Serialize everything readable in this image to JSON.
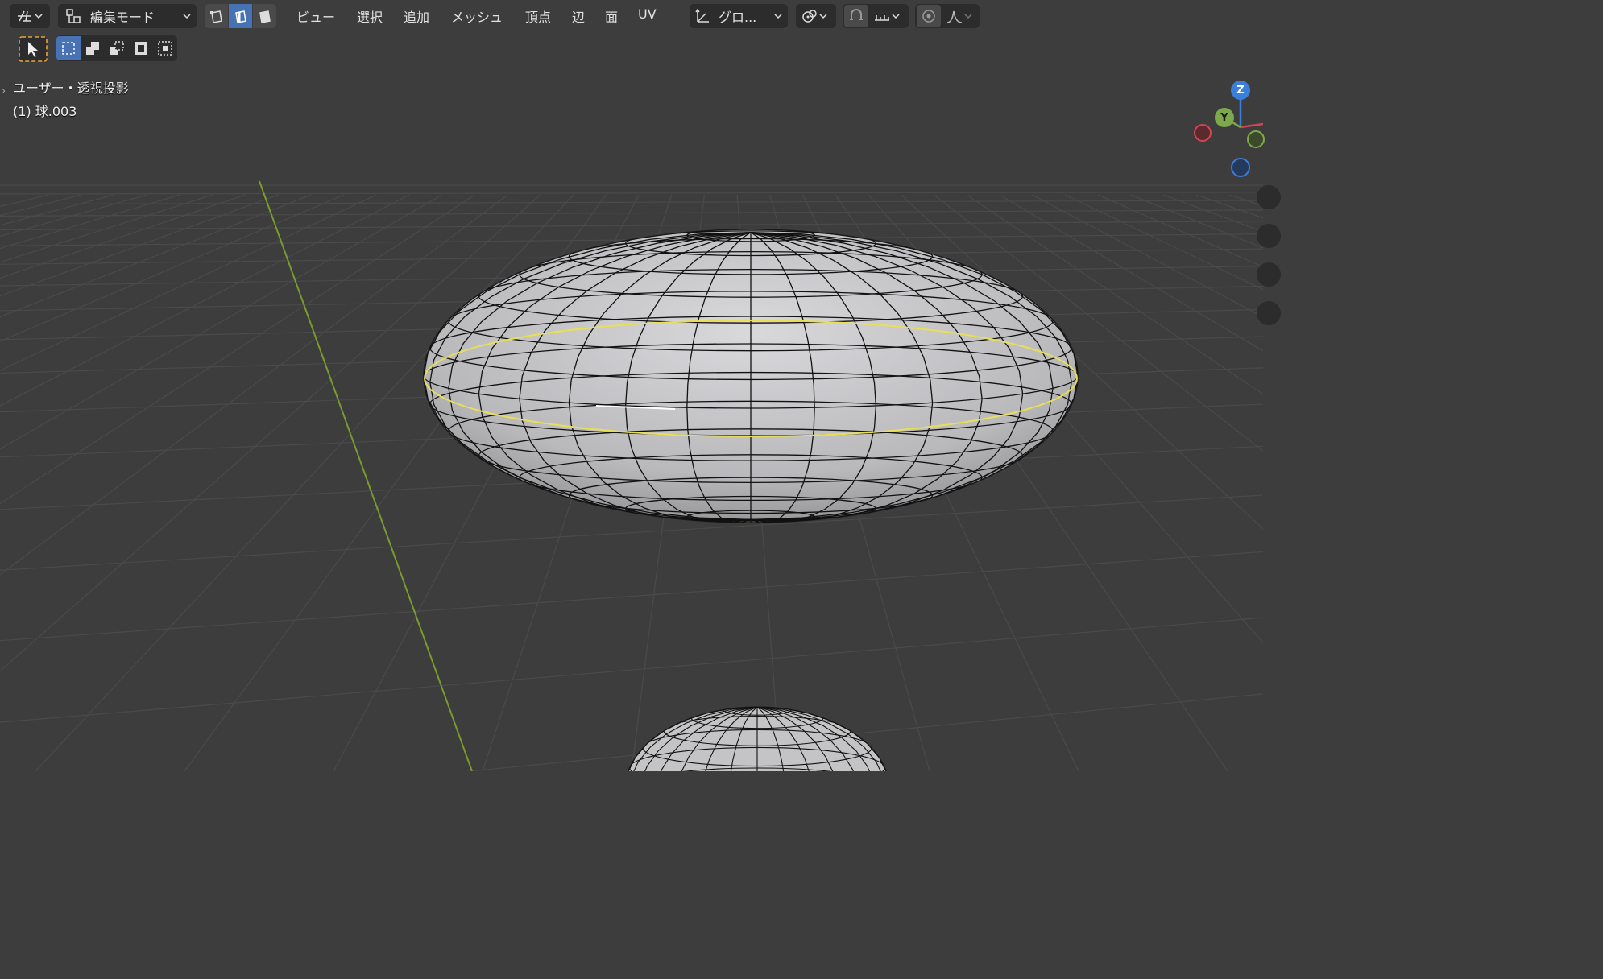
{
  "toolbar": {
    "mode_label": "編集モード",
    "transform_orientation_label": "グロ...",
    "menus": [
      "ビュー",
      "選択",
      "追加",
      "メッシュ",
      "頂点",
      "辺",
      "面",
      "UV"
    ]
  },
  "viewport": {
    "view_label": "ユーザー・透視投影",
    "object_label": "(1) 球.003"
  },
  "gizmo": {
    "z": "Z",
    "y": "Y"
  },
  "colors": {
    "background": "#3d3d3d",
    "header": "#2c2c2c",
    "active_blue": "#4772b3",
    "selected_edge": "#e8d94a",
    "y_axis_green": "#7da84b",
    "x_axis_red": "#d4464f",
    "z_axis_blue": "#3a7fd9"
  }
}
